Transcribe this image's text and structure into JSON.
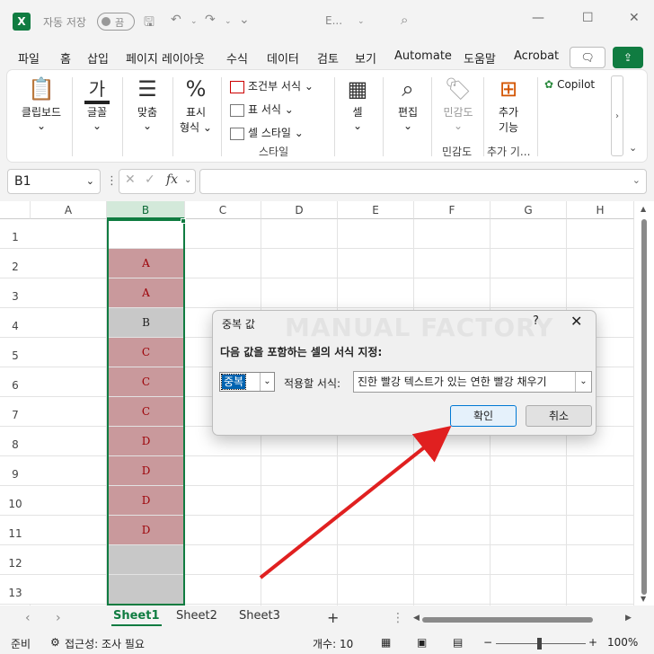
{
  "titlebar": {
    "autosave_label": "자동 저장",
    "autosave_state": "끔",
    "file_name": "E..."
  },
  "menu": [
    "파일",
    "홈",
    "삽입",
    "페이지 레이아웃",
    "수식",
    "데이터",
    "검토",
    "보기",
    "Automate",
    "도움말",
    "Acrobat"
  ],
  "ribbon": {
    "clipboard": "클립보드",
    "font": "글꼴",
    "align": "맞춤",
    "number_line1": "표시",
    "number_line2": "형식",
    "cond_format": "조건부 서식",
    "table_format": "표 서식",
    "cell_style": "셀 스타일",
    "style_group": "스타일",
    "cells": "셀",
    "edit": "편집",
    "sensitivity": "민감도",
    "sensitivity_group": "민감도",
    "addins_line1": "추가",
    "addins_line2": "기능",
    "addins_group": "추가 기...",
    "copilot": "Copilot"
  },
  "formula_bar": {
    "name_box": "B1",
    "fx": "fx",
    "value": ""
  },
  "grid": {
    "columns": [
      "A",
      "B",
      "C",
      "D",
      "E",
      "F",
      "G",
      "H"
    ],
    "rows": [
      "1",
      "2",
      "3",
      "4",
      "5",
      "6",
      "7",
      "8",
      "9",
      "10",
      "11",
      "12",
      "13"
    ],
    "b_values": [
      "",
      "A",
      "A",
      "B",
      "C",
      "C",
      "C",
      "D",
      "D",
      "D",
      "D",
      "",
      ""
    ],
    "dup_fill": "#c9999c",
    "dup_text": "#9c0006",
    "plain_fill": "#c8c8c8"
  },
  "sheets": [
    "Sheet1",
    "Sheet2",
    "Sheet3"
  ],
  "status": {
    "ready": "준비",
    "accessibility": "접근성: 조사 필요",
    "count": "개수: 10",
    "zoom": "100%"
  },
  "dialog": {
    "title": "중복 값",
    "watermark": "MANUAL FACTORY",
    "prompt": "다음 값을 포함하는 셀의 서식 지정:",
    "rule_value": "중복",
    "apply_label": "적용할 서식:",
    "format_value": "진한 빨강 텍스트가 있는 연한 빨강 채우기",
    "ok": "확인",
    "cancel": "취소",
    "help": "?",
    "close": "✕"
  },
  "accent": "#107c41",
  "annotation_arrow_color": "#e02020"
}
